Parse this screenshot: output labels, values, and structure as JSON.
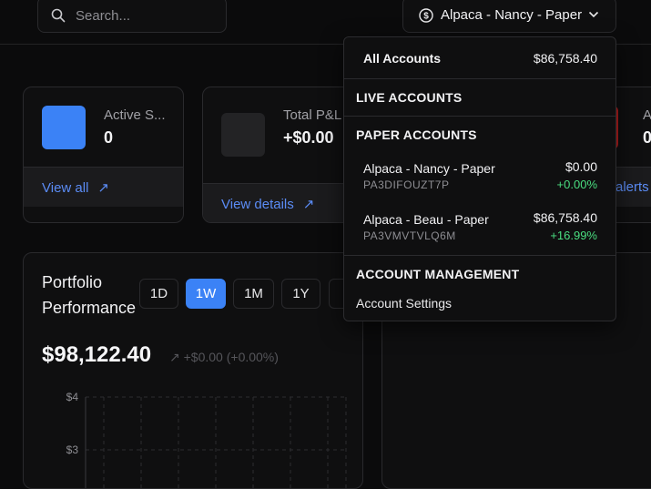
{
  "search": {
    "placeholder": "Search..."
  },
  "account_selector": {
    "label": "Alpaca - Nancy - Paper"
  },
  "stats": [
    {
      "label": "Active S...",
      "value": "0",
      "link": "View all",
      "color": "#3b82f6"
    },
    {
      "label": "Total P&L",
      "value": "+$0.00",
      "link": "View details",
      "color": "#232325"
    },
    {
      "label": "A",
      "value": "0",
      "link": "alerts",
      "color": "#b91c1c"
    }
  ],
  "portfolio": {
    "title": "Portfolio Performance",
    "ranges": [
      "1D",
      "1W",
      "1M",
      "1Y",
      "A"
    ],
    "active_range": "1W",
    "value": "$98,122.40",
    "change": "+$0.00 (+0.00%)",
    "y_ticks": [
      "$4",
      "$3"
    ]
  },
  "dropdown": {
    "all_accounts": {
      "label": "All Accounts",
      "amount": "$86,758.40"
    },
    "live_header": "LIVE ACCOUNTS",
    "paper_header": "PAPER ACCOUNTS",
    "paper_accounts": [
      {
        "name": "Alpaca - Nancy - Paper",
        "code": "PA3DIFOUZT7P",
        "amount": "$0.00",
        "pct": "+0.00%"
      },
      {
        "name": "Alpaca - Beau - Paper",
        "code": "PA3VMVTVLQ6M",
        "amount": "$86,758.40",
        "pct": "+16.99%"
      }
    ],
    "management_header": "ACCOUNT MANAGEMENT",
    "settings_label": "Account Settings"
  },
  "colors": {
    "accent": "#3b82f6",
    "positive": "#4ade80",
    "danger": "#b91c1c"
  },
  "icons": [
    "search-icon",
    "dollar-circle-icon",
    "chevron-down-icon",
    "arrow-up-right-icon"
  ]
}
